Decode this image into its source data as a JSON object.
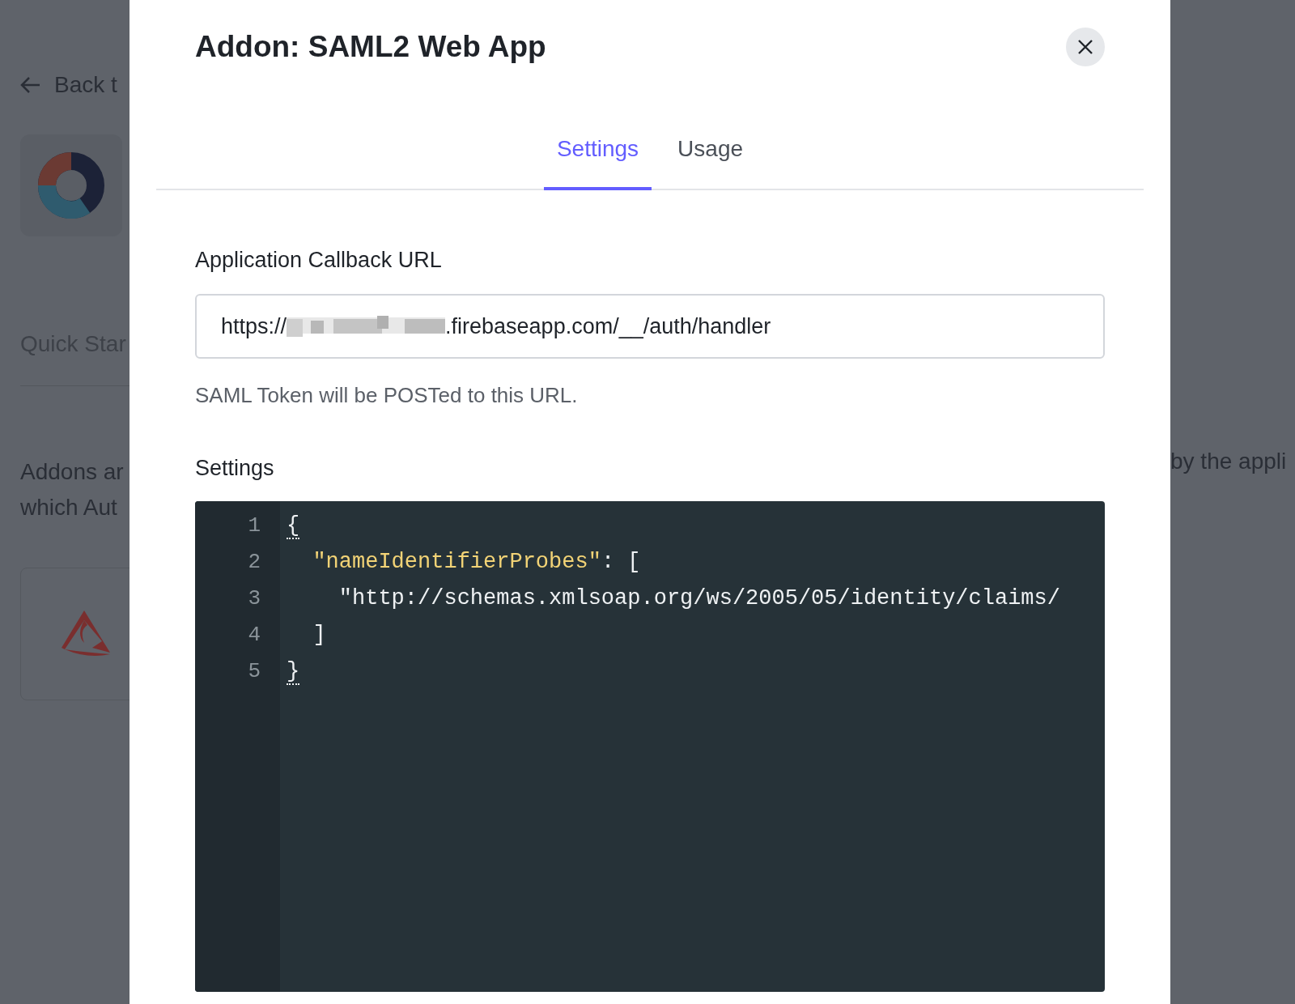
{
  "background": {
    "back_link": "Back t",
    "section_tab": "Quick Star",
    "intro_lines": [
      "Addons ar",
      "which Aut"
    ],
    "intro_right": "by the appli"
  },
  "dialog": {
    "title": "Addon: SAML2 Web App",
    "tabs": [
      {
        "label": "Settings",
        "selected": true
      },
      {
        "label": "Usage",
        "selected": false
      }
    ],
    "callback": {
      "label": "Application Callback URL",
      "value_prefix": "https://",
      "value_suffix": ".firebaseapp.com/__/auth/handler",
      "hint": "SAML Token will be POSTed to this URL."
    },
    "settings": {
      "label": "Settings",
      "lines": [
        {
          "number": "1",
          "tokens": [
            {
              "kind": "bracket",
              "text": "{",
              "highlighted": true
            }
          ]
        },
        {
          "number": "2",
          "tokens": [
            {
              "kind": "key",
              "text": "  \"nameIdentifierProbes\""
            },
            {
              "kind": "plain",
              "text": ": ["
            }
          ]
        },
        {
          "number": "3",
          "tokens": [
            {
              "kind": "plain",
              "text": "    \"http://schemas.xmlsoap.org/ws/2005/05/identity/claims/"
            }
          ]
        },
        {
          "number": "4",
          "tokens": [
            {
              "kind": "plain",
              "text": "  ]"
            }
          ]
        },
        {
          "number": "5",
          "tokens": [
            {
              "kind": "bracket",
              "text": "}",
              "highlighted": true
            }
          ]
        }
      ]
    }
  }
}
